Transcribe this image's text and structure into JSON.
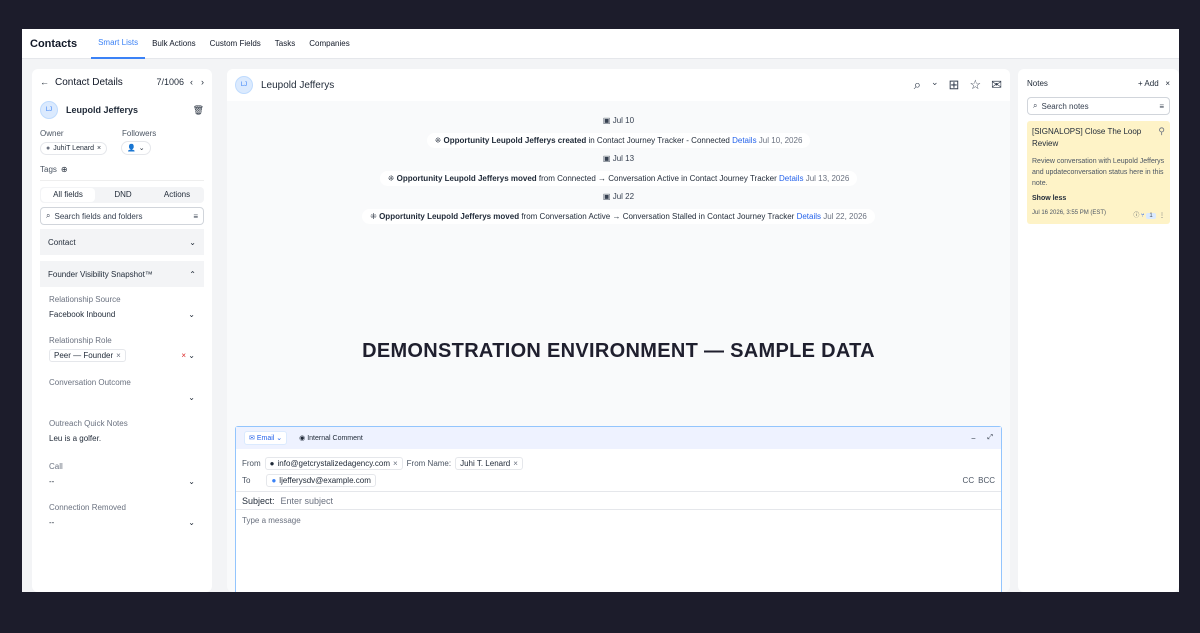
{
  "nav": {
    "brand": "Contacts",
    "tabs": [
      "Smart Lists",
      "Bulk Actions",
      "Custom Fields",
      "Tasks",
      "Companies"
    ]
  },
  "left": {
    "title": "Contact Details",
    "counter": "7/1006",
    "contact": {
      "initials": "LJ",
      "name": "Leupold Jefferys"
    },
    "owner_label": "Owner",
    "followers_label": "Followers",
    "owner_value": "JuhiT Lenard",
    "tags_label": "Tags",
    "segments": [
      "All fields",
      "DND",
      "Actions"
    ],
    "search_placeholder": "Search fields and folders",
    "section_contact": "Contact",
    "section_snapshot": "Founder Visibility Snapshot™",
    "fields": [
      {
        "label": "Relationship Source",
        "value": "Facebook Inbound"
      },
      {
        "label": "Relationship Role",
        "value": "Peer — Founder"
      },
      {
        "label": "Conversation Outcome",
        "value": ""
      },
      {
        "label": "Outreach Quick Notes",
        "value": "Leu is a golfer."
      },
      {
        "label": "Call",
        "value": "--"
      },
      {
        "label": "Connection Removed",
        "value": "--"
      }
    ]
  },
  "center": {
    "contact_initials": "LJ",
    "title": "Leupold Jefferys",
    "events": [
      {
        "date": "Jul 10",
        "bold": "Opportunity Leupold Jefferys created",
        "rest": " in Contact Journey Tracker - Connected",
        "link": "Details",
        "ts": "Jul 10, 2026"
      },
      {
        "date": "Jul 13",
        "bold": "Opportunity Leupold Jefferys moved",
        "rest": " from Connected → Conversation Active in Contact Journey Tracker",
        "link": "Details",
        "ts": "Jul 13, 2026"
      },
      {
        "date": "Jul 22",
        "bold": "Opportunity Leupold Jefferys moved",
        "rest": " from Conversation Active → Conversation Stalled in Contact Journey Tracker",
        "link": "Details",
        "ts": "Jul 22, 2026"
      }
    ],
    "watermark": "DEMONSTRATION ENVIRONMENT — SAMPLE DATA",
    "composer": {
      "tab_email": "Email",
      "tab_comment": "Internal Comment",
      "from_label": "From",
      "from_value": "info@getcrystalizedagency.com",
      "from_name_label": "From Name:",
      "from_name_value": "Juhi T. Lenard",
      "to_label": "To",
      "to_value": "ljefferysdv@example.com",
      "cc": "CC",
      "bcc": "BCC",
      "subject_label": "Subject:",
      "subject_placeholder": "Enter subject",
      "message_placeholder": "Type a message"
    }
  },
  "right": {
    "title": "Notes",
    "add": "Add",
    "search_placeholder": "Search notes",
    "note": {
      "title": "[SIGNALOPS] Close The Loop Review",
      "body": "Review conversation with Leupold Jefferys and updateconversation status here in this note.",
      "show_less": "Show less",
      "date": "Jul 16 2026, 3:55 PM (EST)",
      "count": "1"
    }
  }
}
